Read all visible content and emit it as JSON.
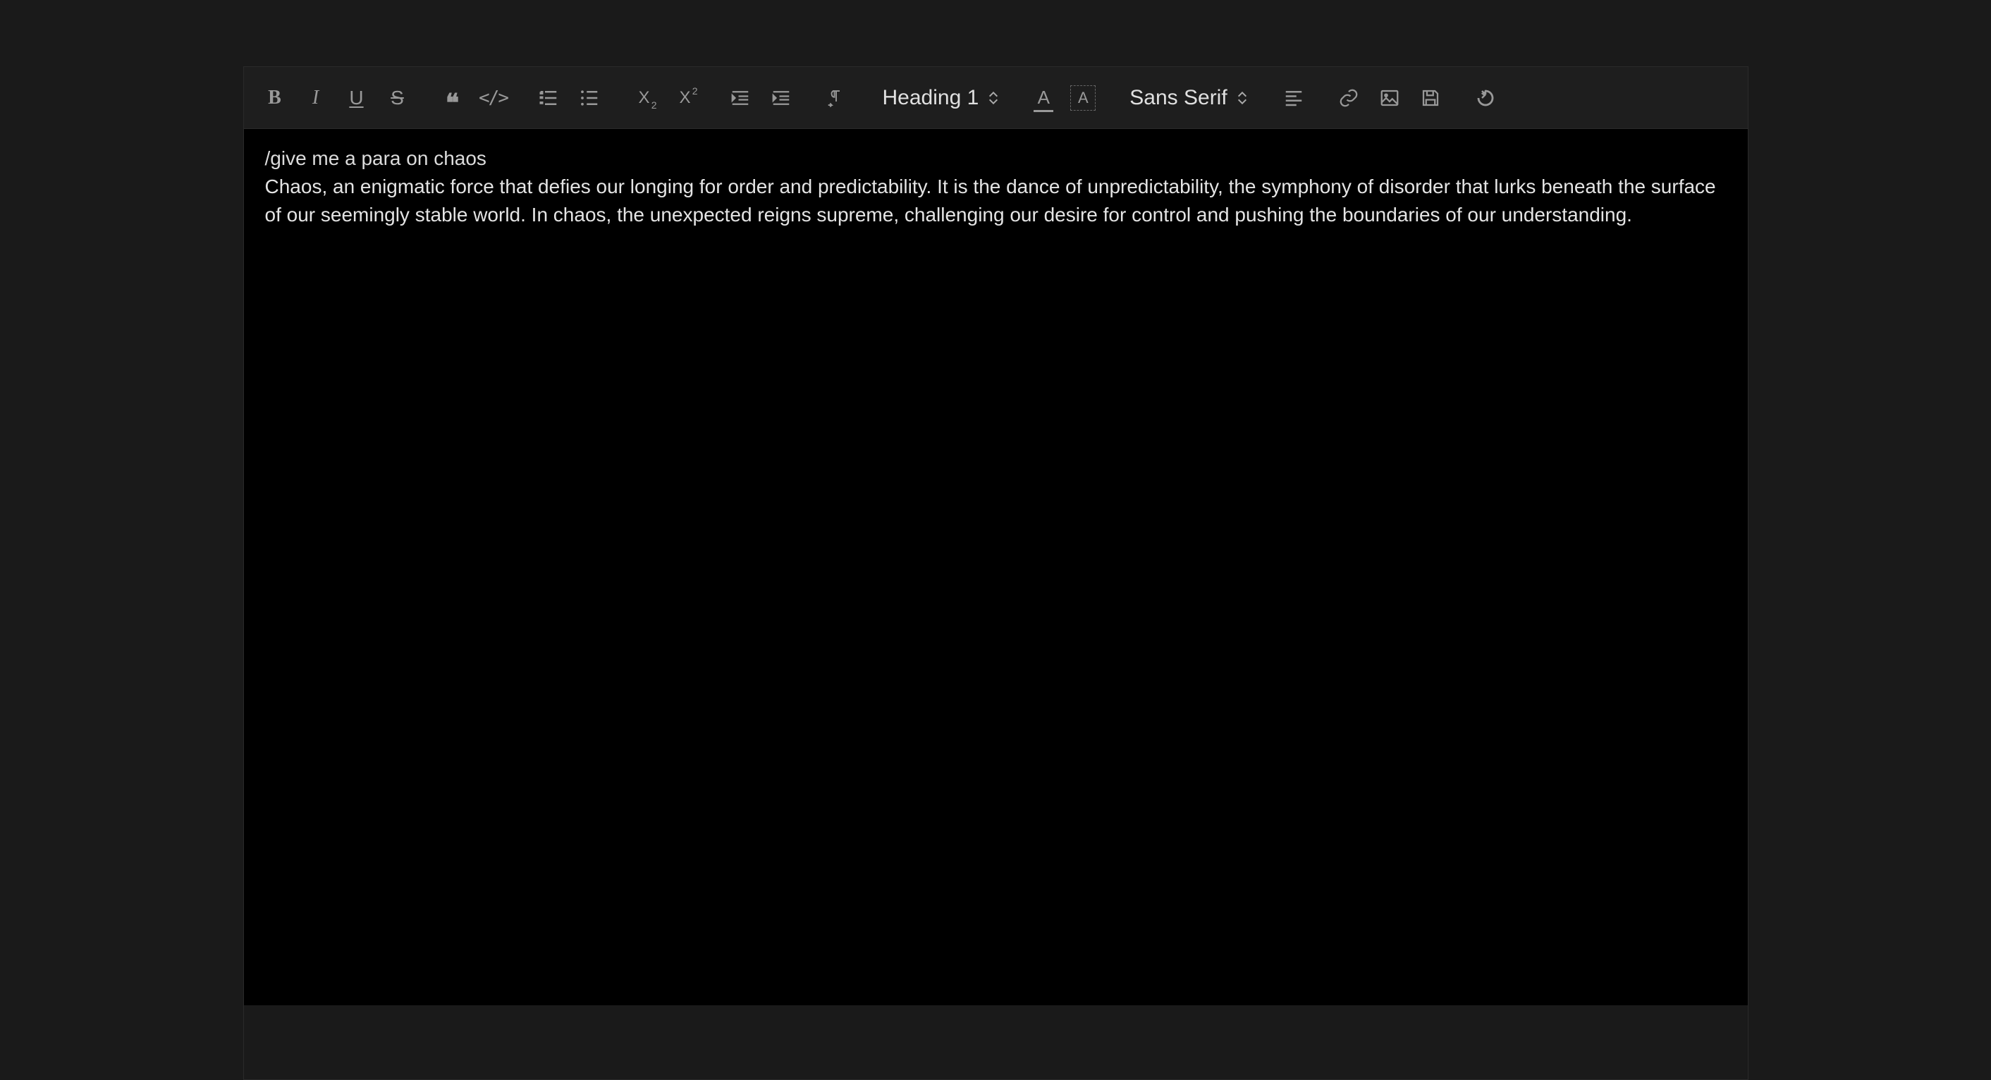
{
  "toolbar": {
    "bold_label": "B",
    "italic_label": "I",
    "underline_label": "U",
    "strike_label": "S",
    "quote_label": "❝",
    "code_label": "</>",
    "sub_label": "X",
    "sup_label": "X",
    "heading_selected": "Heading 1",
    "font_color_letter": "A",
    "bg_color_letter": "A",
    "font_selected": "Sans Serif"
  },
  "content": {
    "prompt": "/give me a para on chaos",
    "response": "Chaos, an enigmatic force that defies our longing for order and predictability. It is the dance of unpredictability, the symphony of disorder that lurks beneath the surface of our seemingly stable world. In chaos, the unexpected reigns supreme, challenging our desire for control and pushing the boundaries of our understanding."
  }
}
